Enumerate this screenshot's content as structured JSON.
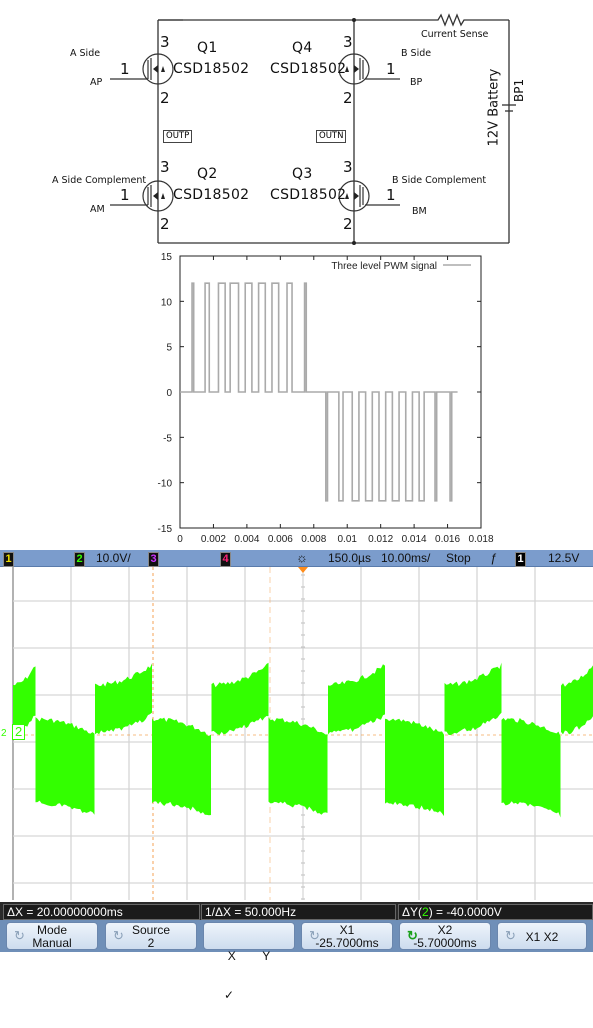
{
  "schematic": {
    "transistors": [
      {
        "ref": "Q1",
        "part": "CSD18502",
        "gate_label": "A Side",
        "net": "AP",
        "pins": {
          "gate": "1",
          "drain": "3",
          "source": "2"
        }
      },
      {
        "ref": "Q4",
        "part": "CSD18502",
        "gate_label": "B Side",
        "net": "BP",
        "pins": {
          "gate": "1",
          "drain": "3",
          "source": "2"
        }
      },
      {
        "ref": "Q2",
        "part": "CSD18502",
        "gate_label": "A Side Complement",
        "net": "AM",
        "pins": {
          "gate": "1",
          "drain": "3",
          "source": "2"
        }
      },
      {
        "ref": "Q3",
        "part": "CSD18502",
        "gate_label": "B Side Complement",
        "net": "BM",
        "pins": {
          "gate": "1",
          "drain": "3",
          "source": "2"
        }
      }
    ],
    "output_nets": {
      "left": "OUTP",
      "right": "OUTN"
    },
    "resistor_label": "Current Sense",
    "battery_label": "12V Battery",
    "battery_ref": "BP1"
  },
  "chart_data": {
    "type": "line",
    "title": "",
    "legend": [
      "Three level PWM signal"
    ],
    "legend_position": "top-right",
    "xlabel": "",
    "ylabel": "",
    "xlim": [
      0,
      0.018
    ],
    "ylim": [
      -15,
      15
    ],
    "xticks": [
      "0",
      "0.002",
      "0.004",
      "0.006",
      "0.008",
      "0.01",
      "0.012",
      "0.014",
      "0.016",
      "0.018"
    ],
    "yticks": [
      "-15",
      "-10",
      "-5",
      "0",
      "5",
      "10",
      "15"
    ],
    "series": [
      {
        "name": "Three level PWM signal",
        "pulses": [
          {
            "start": 0.00072,
            "end": 0.00082,
            "level": 12
          },
          {
            "start": 0.0015,
            "end": 0.00175,
            "level": 12
          },
          {
            "start": 0.0023,
            "end": 0.0027,
            "level": 12
          },
          {
            "start": 0.003,
            "end": 0.0035,
            "level": 12
          },
          {
            "start": 0.0039,
            "end": 0.0043,
            "level": 12
          },
          {
            "start": 0.0047,
            "end": 0.0051,
            "level": 12
          },
          {
            "start": 0.0055,
            "end": 0.0059,
            "level": 12
          },
          {
            "start": 0.0064,
            "end": 0.0067,
            "level": 12
          },
          {
            "start": 0.00745,
            "end": 0.00755,
            "level": 12
          },
          {
            "start": 0.00872,
            "end": 0.00882,
            "level": -12
          },
          {
            "start": 0.0095,
            "end": 0.00975,
            "level": -12
          },
          {
            "start": 0.0103,
            "end": 0.0107,
            "level": -12
          },
          {
            "start": 0.0111,
            "end": 0.0115,
            "level": -12
          },
          {
            "start": 0.0119,
            "end": 0.0123,
            "level": -12
          },
          {
            "start": 0.0127,
            "end": 0.0131,
            "level": -12
          },
          {
            "start": 0.0135,
            "end": 0.0139,
            "level": -12
          },
          {
            "start": 0.0143,
            "end": 0.0146,
            "level": -12
          },
          {
            "start": 0.01525,
            "end": 0.01535,
            "level": -12
          },
          {
            "start": 0.01615,
            "end": 0.01625,
            "level": -12
          }
        ],
        "x_end": 0.0166
      }
    ]
  },
  "scope": {
    "header": {
      "ch1_badge": "1",
      "ch2_badge": "2",
      "ch2_scale": "10.0V/",
      "ch3_badge": "3",
      "ch4_badge": "4",
      "acq_icon": "sun-icon",
      "delay": "150.0µs",
      "timebase": "10.00ms/",
      "run_state": "Stop",
      "trigger_icon": "falling-edge-icon",
      "trigger_source": "1",
      "trigger_level": "12.5V"
    },
    "channel_colors": {
      "ch1": "#f0e000",
      "ch2": "#33ff00",
      "ch3": "#cc33ff",
      "ch4": "#ff2277"
    },
    "ch2_marker": "2",
    "ch2_ground_marker": "2",
    "waveform_color": "#33ff00",
    "cursor_color": "#f5a050",
    "status": {
      "delta_x": "ΔX = 20.00000000ms",
      "inv_delta_x": "1/ΔX = 50.000Hz",
      "delta_y_prefix": "ΔY(",
      "delta_y_channel": "2",
      "delta_y_suffix": ") = -40.0000V"
    },
    "softkeys": [
      {
        "top": "Mode",
        "bottom": "Manual"
      },
      {
        "top": "Source",
        "bottom": "2"
      },
      {
        "top": "X        Y",
        "bottom": "✓"
      },
      {
        "top": "X1",
        "bottom": "-25.7000ms"
      },
      {
        "top": "X2",
        "bottom": "-5.70000ms"
      },
      {
        "top": "X1 X2",
        "bottom": ""
      }
    ]
  }
}
